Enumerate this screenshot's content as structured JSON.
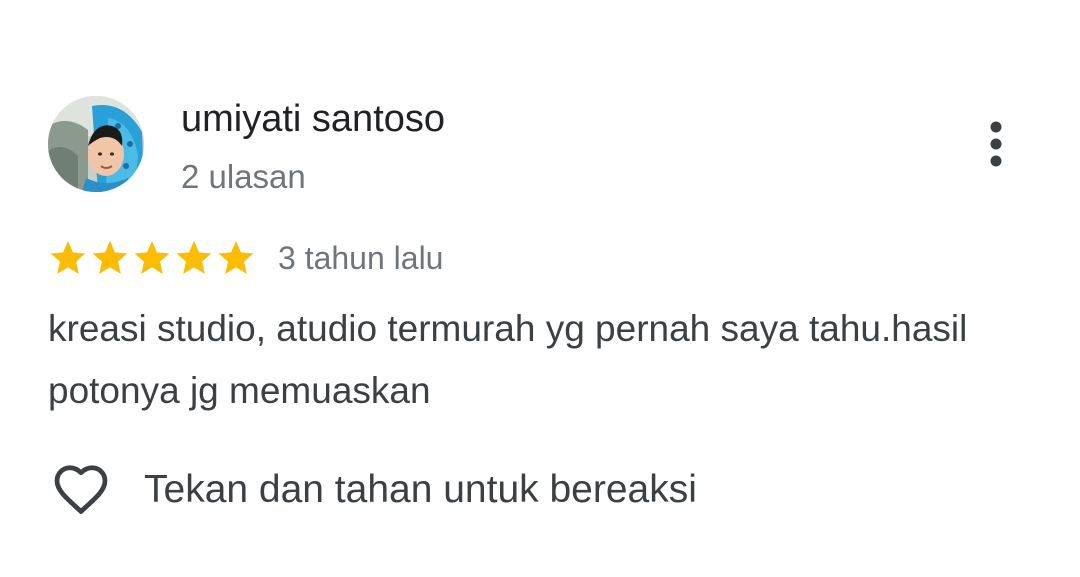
{
  "review": {
    "reviewer_name": "umiyati santoso",
    "review_count": "2 ulasan",
    "rating": 5,
    "rating_max": 5,
    "time": "3 tahun lalu",
    "text": "kreasi studio, atudio termurah yg pernah saya tahu.hasil potonya jg memuaskan"
  },
  "actions": {
    "react_label": "Tekan dan tahan untuk bereaksi"
  },
  "icons": {
    "more": "more-vertical-icon",
    "star": "star-icon",
    "react": "heart-outline-icon"
  },
  "colors": {
    "star": "#fbbc04",
    "secondary_text": "#70757a",
    "primary_text": "#202124",
    "body_text": "#3c4043",
    "icon": "#3c4043"
  }
}
